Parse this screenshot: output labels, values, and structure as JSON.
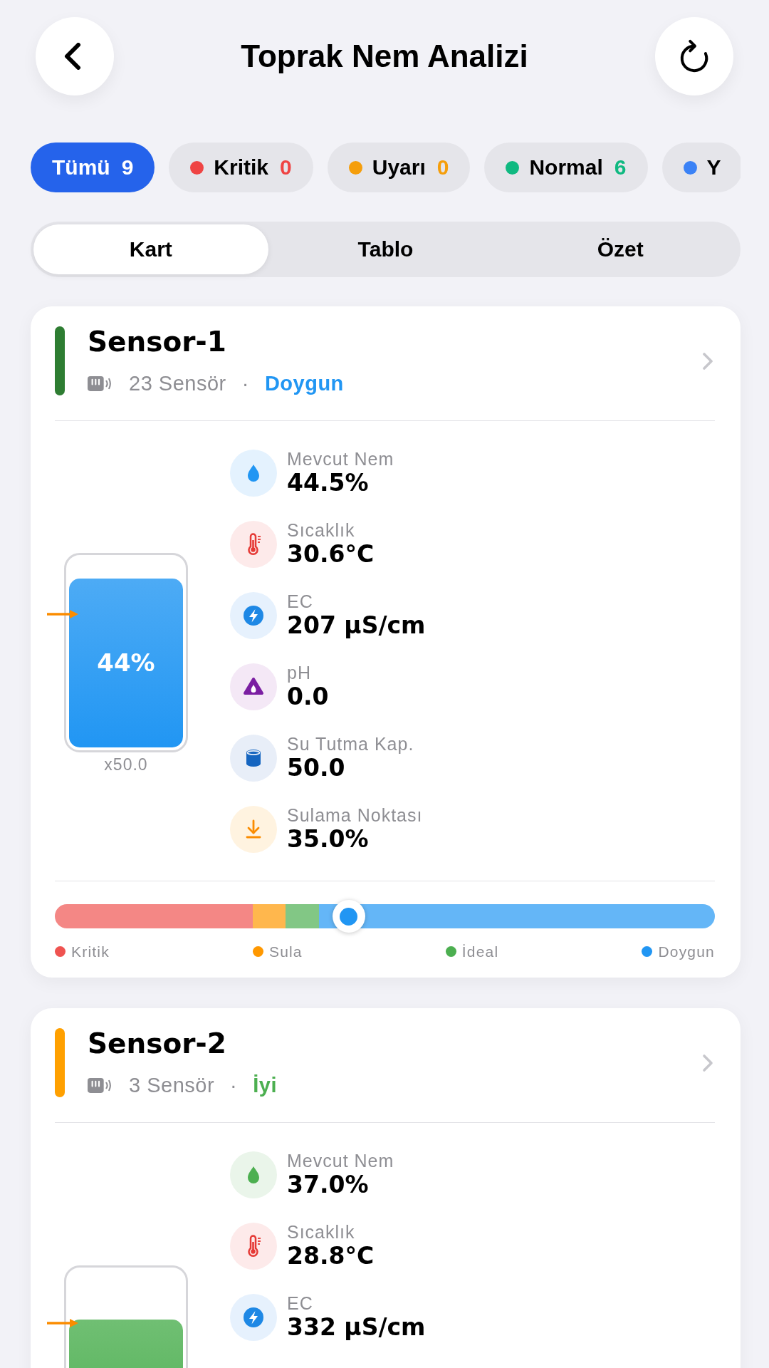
{
  "header": {
    "title": "Toprak Nem Analizi"
  },
  "filters": [
    {
      "label": "Tümü",
      "count": "9",
      "selected": true
    },
    {
      "label": "Kritik",
      "count": "0",
      "color": "#ef4444",
      "selected": false
    },
    {
      "label": "Uyarı",
      "count": "0",
      "color": "#f59e0b",
      "selected": false
    },
    {
      "label": "Normal",
      "count": "6",
      "color": "#10b981",
      "selected": false
    },
    {
      "label": "Y",
      "color": "#3b82f6",
      "selected": false
    }
  ],
  "views": [
    {
      "label": "Kart",
      "selected": true
    },
    {
      "label": "Tablo",
      "selected": false
    },
    {
      "label": "Özet",
      "selected": false
    }
  ],
  "sensors": [
    {
      "name": "Sensor-1",
      "color": "#2e7d32",
      "sensor_count": "23 Sensör",
      "separator": "·",
      "status": {
        "label": "Doygun",
        "color": "#2196f3"
      },
      "tank": {
        "level": 0.89,
        "label": "44%",
        "caption": "x50.0",
        "marker": {
          "level": 0.7
        }
      },
      "metrics": [
        {
          "kind": "moisture",
          "label": "Mevcut Nem",
          "value": "44.5%"
        },
        {
          "kind": "temperature",
          "label": "Sıcaklık",
          "value": "30.6°C"
        },
        {
          "kind": "ec",
          "label": "EC",
          "value": "207 µS/cm"
        },
        {
          "kind": "ph",
          "label": "pH",
          "value": "0.0"
        },
        {
          "kind": "capacity",
          "label": "Su Tutma Kap.",
          "value": "50.0"
        },
        {
          "kind": "irrigation",
          "label": "Sulama Noktası",
          "value": "35.0%"
        }
      ],
      "gauge": {
        "level": 0.445
      },
      "legend": [
        {
          "label": "Kritik",
          "color": "#ef5350"
        },
        {
          "label": "Sula",
          "color": "#ff9800"
        },
        {
          "label": "İdeal",
          "color": "#4caf50"
        },
        {
          "label": "Doygun",
          "color": "#2196f3"
        }
      ]
    },
    {
      "name": "Sensor-2",
      "color": "#ffa000",
      "sensor_count": "3 Sensör",
      "separator": "·",
      "status": {
        "label": "İyi",
        "color": "#4caf50"
      },
      "tank": {
        "level": 0.74,
        "marker": {
          "level": 0.72
        }
      },
      "metrics": [
        {
          "kind": "moisture",
          "label": "Mevcut Nem",
          "value": "37.0%"
        },
        {
          "kind": "temperature",
          "label": "Sıcaklık",
          "value": "28.8°C"
        },
        {
          "kind": "ec",
          "label": "EC",
          "value": "332 µS/cm"
        }
      ]
    }
  ]
}
